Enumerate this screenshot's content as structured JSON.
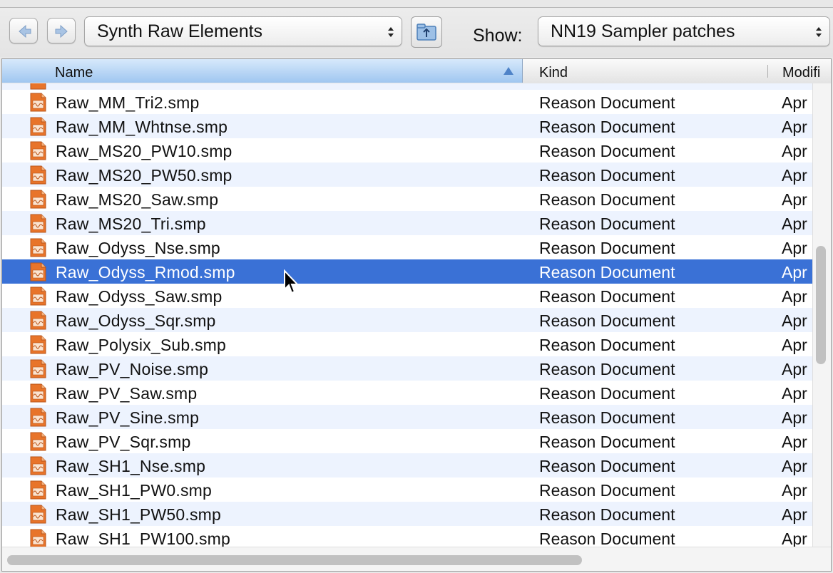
{
  "toolbar": {
    "back_icon": "back-arrow-icon",
    "forward_icon": "forward-arrow-icon",
    "location": "Synth Raw Elements",
    "up_icon": "parent-folder-icon",
    "show_label": "Show:",
    "show_filter": "NN19 Sampler patches"
  },
  "columns": {
    "name": "Name",
    "kind": "Kind",
    "modified": "Modifi"
  },
  "files": [
    {
      "name": "Raw_MM_Tri2.smp",
      "kind": "Reason Document",
      "modified": "Apr",
      "selected": false
    },
    {
      "name": "Raw_MM_Whtnse.smp",
      "kind": "Reason Document",
      "modified": "Apr",
      "selected": false
    },
    {
      "name": "Raw_MS20_PW10.smp",
      "kind": "Reason Document",
      "modified": "Apr",
      "selected": false
    },
    {
      "name": "Raw_MS20_PW50.smp",
      "kind": "Reason Document",
      "modified": "Apr",
      "selected": false
    },
    {
      "name": "Raw_MS20_Saw.smp",
      "kind": "Reason Document",
      "modified": "Apr",
      "selected": false
    },
    {
      "name": "Raw_MS20_Tri.smp",
      "kind": "Reason Document",
      "modified": "Apr",
      "selected": false
    },
    {
      "name": "Raw_Odyss_Nse.smp",
      "kind": "Reason Document",
      "modified": "Apr",
      "selected": false
    },
    {
      "name": "Raw_Odyss_Rmod.smp",
      "kind": "Reason Document",
      "modified": "Apr",
      "selected": true
    },
    {
      "name": "Raw_Odyss_Saw.smp",
      "kind": "Reason Document",
      "modified": "Apr",
      "selected": false
    },
    {
      "name": "Raw_Odyss_Sqr.smp",
      "kind": "Reason Document",
      "modified": "Apr",
      "selected": false
    },
    {
      "name": "Raw_Polysix_Sub.smp",
      "kind": "Reason Document",
      "modified": "Apr",
      "selected": false
    },
    {
      "name": "Raw_PV_Noise.smp",
      "kind": "Reason Document",
      "modified": "Apr",
      "selected": false
    },
    {
      "name": "Raw_PV_Saw.smp",
      "kind": "Reason Document",
      "modified": "Apr",
      "selected": false
    },
    {
      "name": "Raw_PV_Sine.smp",
      "kind": "Reason Document",
      "modified": "Apr",
      "selected": false
    },
    {
      "name": "Raw_PV_Sqr.smp",
      "kind": "Reason Document",
      "modified": "Apr",
      "selected": false
    },
    {
      "name": "Raw_SH1_Nse.smp",
      "kind": "Reason Document",
      "modified": "Apr",
      "selected": false
    },
    {
      "name": "Raw_SH1_PW0.smp",
      "kind": "Reason Document",
      "modified": "Apr",
      "selected": false
    },
    {
      "name": "Raw_SH1_PW50.smp",
      "kind": "Reason Document",
      "modified": "Apr",
      "selected": false
    },
    {
      "name": "Raw_SH1_PW100.smp",
      "kind": "Reason Document",
      "modified": "Apr",
      "selected": false
    }
  ],
  "file_icon": "reason-sample-file-icon",
  "colors": {
    "selection": "#3a71d6",
    "alt_row": "#edf3fe",
    "icon_orange": "#e8742a"
  }
}
